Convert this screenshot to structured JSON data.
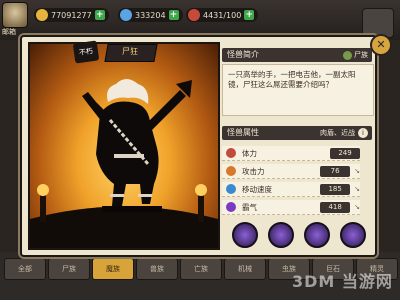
{
  "topbar": {
    "avatar_label": "邮箱",
    "resources": [
      {
        "name": "gold",
        "value": "77091277",
        "color": "#e6b43c"
      },
      {
        "name": "gem",
        "value": "333204",
        "color": "#5aa4e6"
      },
      {
        "name": "energy",
        "value": "4431/100",
        "color": "#c84a3a"
      }
    ],
    "plus_label": "+"
  },
  "character": {
    "name": "尸狂",
    "badge": "不朽"
  },
  "intro": {
    "header": "怪兽简介",
    "race_tag": "尸族",
    "description": "一只高举的手，一把电吉他，一副太阳镜，尸狂这么屌还需要介绍吗？"
  },
  "attributes": {
    "header": "怪兽属性",
    "type_tag": "肉盾、近战",
    "info_icon": "i",
    "stats": [
      {
        "label": "体力",
        "value": "249",
        "icon_color": "#c24a3a"
      },
      {
        "label": "攻击力",
        "value": "76",
        "icon_color": "#d8782a"
      },
      {
        "label": "移动速度",
        "value": "185",
        "icon_color": "#3a8ad0"
      },
      {
        "label": "霸气",
        "value": "418",
        "icon_color": "#7a3ac4"
      }
    ],
    "arrow": "↘"
  },
  "skills": [
    "skill-1",
    "skill-2",
    "skill-3",
    "skill-4"
  ],
  "close_label": "✕",
  "bottom_tabs": [
    "全部",
    "尸族",
    "魔族",
    "兽族",
    "亡族",
    "机械",
    "虫族",
    "巨石",
    "精灵"
  ],
  "watermark": "3DM 当游网"
}
